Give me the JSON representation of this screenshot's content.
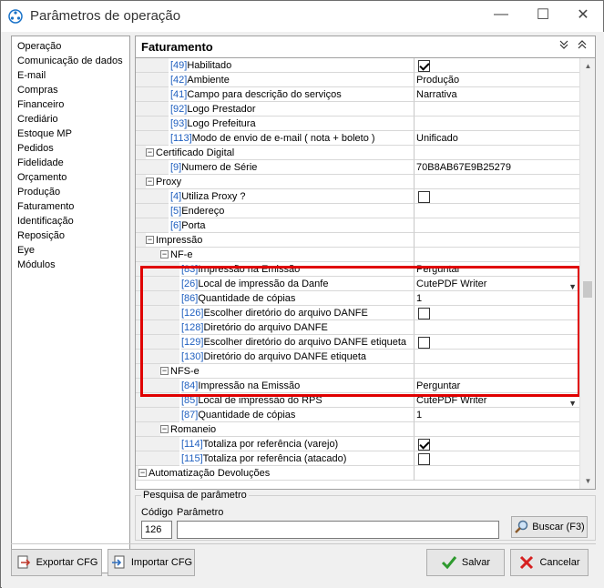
{
  "window": {
    "title": "Parâmetros de operação",
    "minimize_glyph": "—",
    "maximize_glyph": "☐",
    "close_glyph": "✕"
  },
  "nav": {
    "items": [
      "Operação",
      "Comunicação de dados",
      "E-mail",
      "Compras",
      "Financeiro",
      "Crediário",
      "Estoque MP",
      "Pedidos",
      "Fidelidade",
      "Orçamento",
      "Produção",
      "Faturamento",
      "Identificação",
      "Reposição",
      "Eye",
      "Módulos"
    ]
  },
  "section": {
    "title": "Faturamento"
  },
  "rows": [
    {
      "level": 3,
      "code": "[49]",
      "label": "Habilitado",
      "type": "check",
      "checked": true
    },
    {
      "level": 3,
      "code": "[42]",
      "label": "Ambiente",
      "type": "text",
      "value": "Produção"
    },
    {
      "level": 3,
      "code": "[41]",
      "label": "Campo para descrição do serviços",
      "type": "text",
      "value": "Narrativa"
    },
    {
      "level": 3,
      "code": "[92]",
      "label": "Logo Prestador",
      "type": "text",
      "value": ""
    },
    {
      "level": 3,
      "code": "[93]",
      "label": "Logo Prefeitura",
      "type": "text",
      "value": ""
    },
    {
      "level": 3,
      "code": "[113]",
      "label": "Modo de envio de e-mail ( nota + boleto )",
      "type": "text",
      "value": "Unificado"
    },
    {
      "level": 1,
      "group": true,
      "label": "Certificado Digital"
    },
    {
      "level": 3,
      "code": "[9]",
      "label": "Numero de Série",
      "type": "text",
      "value": "70B8AB67E9B25279"
    },
    {
      "level": 1,
      "group": true,
      "label": "Proxy"
    },
    {
      "level": 3,
      "code": "[4]",
      "label": "Utiliza Proxy ?",
      "type": "check",
      "checked": false
    },
    {
      "level": 3,
      "code": "[5]",
      "label": "Endereço",
      "type": "text",
      "value": ""
    },
    {
      "level": 3,
      "code": "[6]",
      "label": "Porta",
      "type": "text",
      "value": ""
    },
    {
      "level": 1,
      "group": true,
      "label": "Impressão"
    },
    {
      "level": 2,
      "group": true,
      "label": "NF-e"
    },
    {
      "level": 4,
      "code": "[83]",
      "label": "Impressão na Emissão",
      "type": "text",
      "value": "Perguntar"
    },
    {
      "level": 4,
      "code": "[26]",
      "label": "Local de impressão da Danfe",
      "type": "dropdown",
      "value": "CutePDF Writer"
    },
    {
      "level": 4,
      "code": "[86]",
      "label": "Quantidade de cópias",
      "type": "text",
      "value": "1"
    },
    {
      "level": 4,
      "code": "[126]",
      "label": "Escolher diretório do arquivo DANFE",
      "type": "check",
      "checked": false
    },
    {
      "level": 4,
      "code": "[128]",
      "label": "Diretório do arquivo DANFE",
      "type": "text",
      "value": ""
    },
    {
      "level": 4,
      "code": "[129]",
      "label": "Escolher diretório do arquivo DANFE  etiqueta",
      "type": "check",
      "checked": false
    },
    {
      "level": 4,
      "code": "[130]",
      "label": "Diretório do arquivo DANFE etiqueta",
      "type": "text",
      "value": ""
    },
    {
      "level": 2,
      "group": true,
      "label": "NFS-e"
    },
    {
      "level": 4,
      "code": "[84]",
      "label": "Impressão na Emissão",
      "type": "text",
      "value": "Perguntar"
    },
    {
      "level": 4,
      "code": "[85]",
      "label": "Local de impressão do RPS",
      "type": "dropdown",
      "value": "CutePDF Writer"
    },
    {
      "level": 4,
      "code": "[87]",
      "label": "Quantidade de cópias",
      "type": "text",
      "value": "1"
    },
    {
      "level": 2,
      "group": true,
      "label": "Romaneio"
    },
    {
      "level": 4,
      "code": "[114]",
      "label": "Totaliza por referência (varejo)",
      "type": "check",
      "checked": true
    },
    {
      "level": 4,
      "code": "[115]",
      "label": "Totaliza por referência (atacado)",
      "type": "check",
      "checked": false
    },
    {
      "level": 0,
      "group": true,
      "label": "Automatização Devoluções"
    }
  ],
  "search": {
    "legend": "Pesquisa de parâmetro",
    "code_label": "Código",
    "param_label": "Parâmetro",
    "code_value": "126",
    "param_value": "",
    "button_label": "Buscar (F3)"
  },
  "buttons": {
    "export": "Exportar CFG",
    "import": "Importar CFG",
    "save": "Salvar",
    "cancel": "Cancelar"
  },
  "colors": {
    "highlight": "#e00000",
    "code": "#1f5fbf"
  }
}
